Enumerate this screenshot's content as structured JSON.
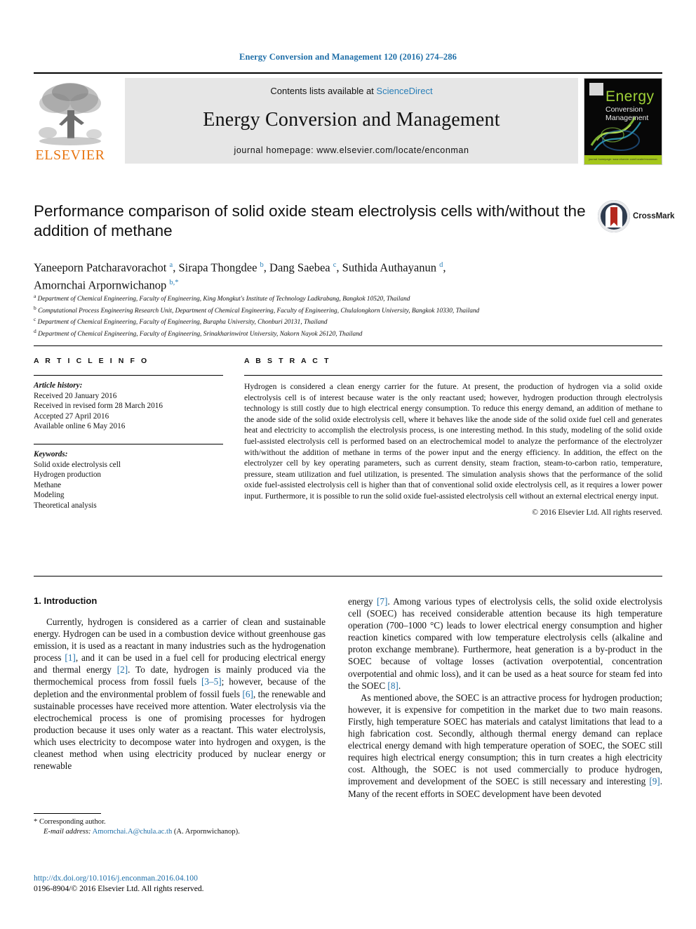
{
  "running_head": "Energy Conversion and Management 120 (2016) 274–286",
  "masthead": {
    "publisher": "ELSEVIER",
    "contents_prefix": "Contents lists available at ",
    "contents_link": "ScienceDirect",
    "journal_title": "Energy Conversion and Management",
    "homepage": "journal homepage: www.elsevier.com/locate/enconman",
    "cover": {
      "title": "Energy",
      "subtitle_line1": "Conversion",
      "subtitle_line2": "Management",
      "strip_text": "journal homepage: www.elsevier.com/locate/enconman"
    }
  },
  "article": {
    "title": "Performance comparison of solid oxide steam electrolysis cells with/without the addition of methane",
    "crossmark_label": "CrossMark",
    "authors_line1": "Yaneeporn Patcharavorachot <sup>a</sup>, Sirapa Thongdee <sup>b</sup>, Dang Saebea <sup>c</sup>, Suthida Authayanun <sup>d</sup>,",
    "authors_line2": "Amornchai Arpornwichanop <sup>b,</sup><sup>*</sup>",
    "affiliations": [
      "<sup>a</sup> Department of Chemical Engineering, Faculty of Engineering, King Mongkut's Institute of Technology Ladkrabang, Bangkok 10520, Thailand",
      "<sup>b</sup> Computational Process Engineering Research Unit, Department of Chemical Engineering, Faculty of Engineering, Chulalongkorn University, Bangkok 10330, Thailand",
      "<sup>c</sup> Department of Chemical Engineering, Faculty of Engineering, Burapha University, Chonburi 20131, Thailand",
      "<sup>d</sup> Department of Chemical Engineering, Faculty of Engineering, Srinakharinwirot University, Nakorn Nayok 26120, Thailand"
    ]
  },
  "article_info": {
    "heading": "A R T I C L E  I N F O",
    "history_label": "Article history:",
    "history": [
      "Received 20 January 2016",
      "Received in revised form 28 March 2016",
      "Accepted 27 April 2016",
      "Available online 6 May 2016"
    ],
    "keywords_label": "Keywords:",
    "keywords": [
      "Solid oxide electrolysis cell",
      "Hydrogen production",
      "Methane",
      "Modeling",
      "Theoretical analysis"
    ]
  },
  "abstract": {
    "heading": "A B S T R A C T",
    "text": "Hydrogen is considered a clean energy carrier for the future. At present, the production of hydrogen via a solid oxide electrolysis cell is of interest because water is the only reactant used; however, hydrogen production through electrolysis technology is still costly due to high electrical energy consumption. To reduce this energy demand, an addition of methane to the anode side of the solid oxide electrolysis cell, where it behaves like the anode side of the solid oxide fuel cell and generates heat and electricity to accomplish the electrolysis process, is one interesting method. In this study, modeling of the solid oxide fuel-assisted electrolysis cell is performed based on an electrochemical model to analyze the performance of the electrolyzer with/without the addition of methane in terms of the power input and the energy efficiency. In addition, the effect on the electrolyzer cell by key operating parameters, such as current density, steam fraction, steam-to-carbon ratio, temperature, pressure, steam utilization and fuel utilization, is presented. The simulation analysis shows that the performance of the solid oxide fuel-assisted electrolysis cell is higher than that of conventional solid oxide electrolysis cell, as it requires a lower power input. Furthermore, it is possible to run the solid oxide fuel-assisted electrolysis cell without an external electrical energy input.",
    "copyright": "© 2016 Elsevier Ltd. All rights reserved."
  },
  "introduction": {
    "heading": "1. Introduction",
    "left_paragraph": "Currently, hydrogen is considered as a carrier of clean and sustainable energy. Hydrogen can be used in a combustion device without greenhouse gas emission, it is used as a reactant in many industries such as the hydrogenation process <span class=\"cite\">[1]</span>, and it can be used in a fuel cell for producing electrical energy and thermal energy <span class=\"cite\">[2]</span>. To date, hydrogen is mainly produced via the thermochemical process from fossil fuels <span class=\"cite\">[3–5]</span>; however, because of the depletion and the environmental problem of fossil fuels <span class=\"cite\">[6]</span>, the renewable and sustainable processes have received more attention. Water electrolysis via the electrochemical process is one of promising processes for hydrogen production because it uses only water as a reactant. This water electrolysis, which uses electricity to decompose water into hydrogen and oxygen, is the cleanest method when using electricity produced by nuclear energy or renewable",
    "right_paragraph_1": "energy <span class=\"cite\">[7]</span>. Among various types of electrolysis cells, the solid oxide electrolysis cell (SOEC) has received considerable attention because its high temperature operation (700–1000 °C) leads to lower electrical energy consumption and higher reaction kinetics compared with low temperature electrolysis cells (alkaline and proton exchange membrane). Furthermore, heat generation is a by-product in the SOEC because of voltage losses (activation overpotential, concentration overpotential and ohmic loss), and it can be used as a heat source for steam fed into the SOEC <span class=\"cite\">[8]</span>.",
    "right_paragraph_2": "As mentioned above, the SOEC is an attractive process for hydrogen production; however, it is expensive for competition in the market due to two main reasons. Firstly, high temperature SOEC has materials and catalyst limitations that lead to a high fabrication cost. Secondly, although thermal energy demand can replace electrical energy demand with high temperature operation of SOEC, the SOEC still requires high electrical energy consumption; this in turn creates a high electricity cost. Although, the SOEC is not used commercially to produce hydrogen, improvement and development of the SOEC is still necessary and interesting <span class=\"cite\">[9]</span>. Many of the recent efforts in SOEC development have been devoted"
  },
  "footnotes": {
    "corresponding": "* Corresponding author.",
    "email_label": "E-mail address:",
    "email": "Amornchai.A@chula.ac.th",
    "email_suffix": "(A. Arpornwichanop).",
    "doi": "http://dx.doi.org/10.1016/j.enconman.2016.04.100",
    "issn_line": "0196-8904/© 2016 Elsevier Ltd. All rights reserved."
  }
}
